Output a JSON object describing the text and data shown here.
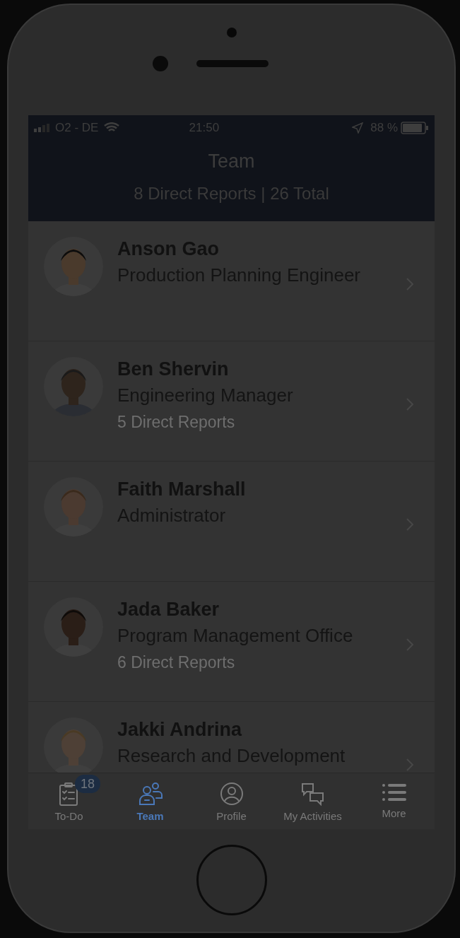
{
  "status_bar": {
    "carrier": "O2 - DE",
    "time": "21:50",
    "battery": "88 %"
  },
  "header": {
    "title": "Team",
    "subtitle": "8 Direct Reports | 26 Total"
  },
  "people": [
    {
      "name": "Anson Gao",
      "title": "Production Planning Engineer"
    },
    {
      "name": "Ben Shervin",
      "title": "Engineering Manager",
      "reports": "5 Direct Reports"
    },
    {
      "name": "Faith Marshall",
      "title": "Administrator"
    },
    {
      "name": "Jada Baker",
      "title": "Program Management Office",
      "reports": "6 Direct Reports"
    },
    {
      "name": "Jakki Andrina",
      "title": "Research and Development"
    }
  ],
  "tabs": [
    {
      "label": "To-Do",
      "selected": false,
      "badge": "18"
    },
    {
      "label": "Team",
      "selected": true
    },
    {
      "label": "Profile",
      "selected": false
    },
    {
      "label": "My Activities",
      "selected": false
    },
    {
      "label": "More",
      "selected": false
    }
  ]
}
